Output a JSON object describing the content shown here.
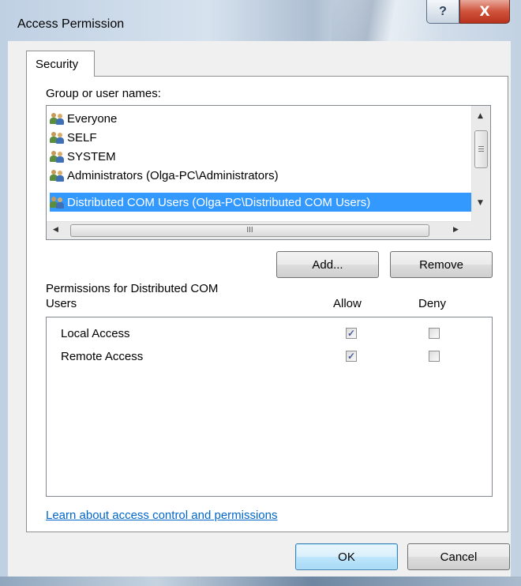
{
  "window": {
    "title": "Access Permission",
    "help_glyph": "?",
    "close_glyph": "X"
  },
  "tabs": [
    {
      "label": "Security"
    }
  ],
  "group_list": {
    "label": "Group or user names:",
    "items": [
      {
        "name": "Everyone",
        "selected": false
      },
      {
        "name": "SELF",
        "selected": false
      },
      {
        "name": "SYSTEM",
        "selected": false
      },
      {
        "name": "Administrators (Olga-PC\\Administrators)",
        "selected": false
      },
      {
        "name": "Distributed COM Users (Olga-PC\\Distributed COM Users)",
        "selected": true
      }
    ],
    "hscroll_grip": "III"
  },
  "buttons": {
    "add": "Add...",
    "remove": "Remove",
    "ok": "OK",
    "cancel": "Cancel"
  },
  "permissions": {
    "label_line1": "Permissions for Distributed COM",
    "label_line2": "Users",
    "col_allow": "Allow",
    "col_deny": "Deny",
    "rows": [
      {
        "name": "Local Access",
        "allow": true,
        "deny": false
      },
      {
        "name": "Remote Access",
        "allow": true,
        "deny": false
      }
    ]
  },
  "link": "Learn about access control and permissions",
  "colors": {
    "selection": "#3399ff",
    "link": "#0066cc",
    "close": "#c8412b"
  }
}
